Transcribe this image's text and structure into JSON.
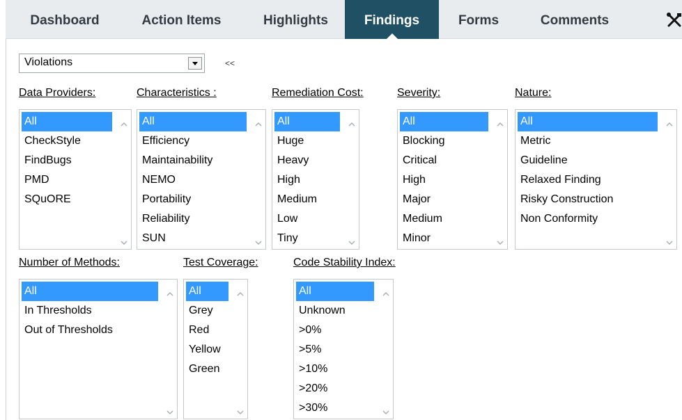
{
  "tabs": [
    {
      "label": "Dashboard",
      "active": false
    },
    {
      "label": "Action Items",
      "active": false
    },
    {
      "label": "Highlights",
      "active": false
    },
    {
      "label": "Findings",
      "active": true
    },
    {
      "label": "Forms",
      "active": false
    },
    {
      "label": "Comments",
      "active": false
    }
  ],
  "tools_icon": "wrench-screwdriver-icon",
  "view_select": {
    "value": "Violations"
  },
  "collapse_label": "<<",
  "filters": [
    {
      "label": "Data Providers:",
      "options": [
        "All",
        "CheckStyle",
        "FindBugs",
        "PMD",
        "SQuORE"
      ],
      "selected": "All"
    },
    {
      "label": "Characteristics :",
      "options": [
        "All",
        "Efficiency",
        "Maintainability",
        "NEMO",
        "Portability",
        "Reliability",
        "SUN"
      ],
      "selected": "All"
    },
    {
      "label": "Remediation Cost:",
      "options": [
        "All",
        "Huge",
        "Heavy",
        "High",
        "Medium",
        "Low",
        "Tiny"
      ],
      "selected": "All"
    },
    {
      "label": "Severity:",
      "options": [
        "All",
        "Blocking",
        "Critical",
        "High",
        "Major",
        "Medium",
        "Minor"
      ],
      "selected": "All"
    },
    {
      "label": "Nature:",
      "options": [
        "All",
        "Metric",
        "Guideline",
        "Relaxed Finding",
        "Risky Construction",
        "Non Conformity"
      ],
      "selected": "All"
    },
    {
      "label": "Number of Methods:",
      "options": [
        "All",
        "In Thresholds",
        "Out of Thresholds"
      ],
      "selected": "All"
    },
    {
      "label": "Test Coverage:",
      "options": [
        "All",
        "Grey",
        "Red",
        "Yellow",
        "Green"
      ],
      "selected": "All"
    },
    {
      "label": "Code Stability Index:",
      "options": [
        "All",
        "Unknown",
        ">0%",
        ">5%",
        ">10%",
        ">20%",
        ">30%"
      ],
      "selected": "All"
    }
  ],
  "colors": {
    "tab_active": "#1f5063",
    "tabbar": "#e9ecef",
    "selection": "#3399ff"
  }
}
